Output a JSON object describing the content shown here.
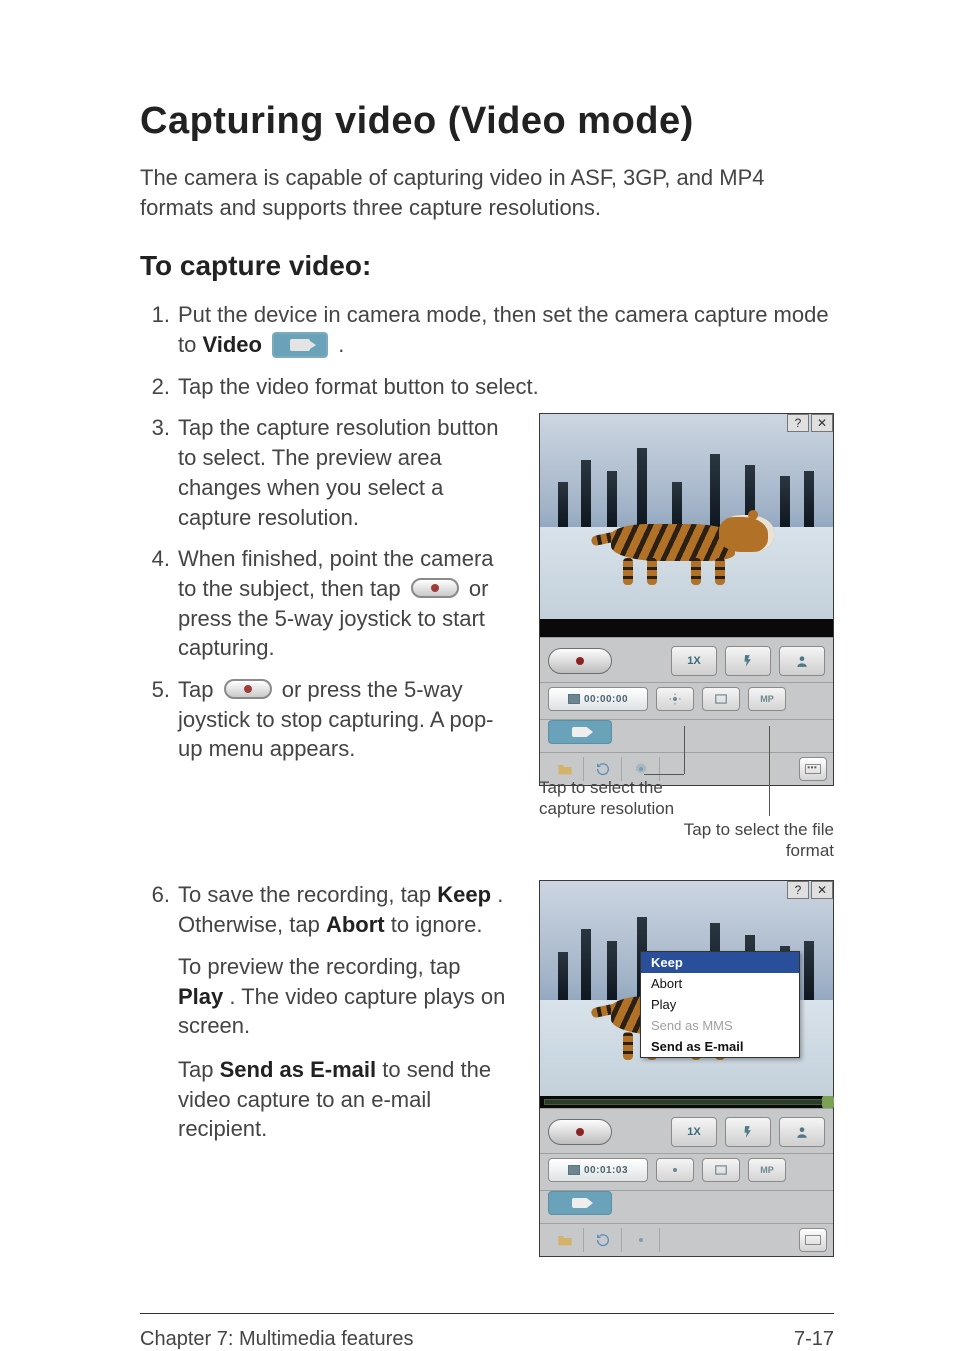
{
  "heading": "Capturing video (Video mode)",
  "intro": "The camera is capable of capturing video in ASF, 3GP, and MP4 formats and supports three capture resolutions.",
  "subheading": "To capture video:",
  "steps": {
    "s1a": "Put the device in camera mode, then set the camera capture mode to ",
    "s1b_bold": "Video",
    "s1c": ".",
    "s2": "Tap the video format button to select.",
    "s3": "Tap the capture resolution button to select. The preview area changes when you select a capture resolution.",
    "s4a": "When finished, point the camera to the subject, then tap ",
    "s4b": " or press the 5-way joystick to start capturing.",
    "s5a": "Tap ",
    "s5b": " or press the 5-way joystick to stop capturing. A pop-up menu appears.",
    "s6a": "To save the recording, tap ",
    "s6_keep": "Keep",
    "s6b": ". Otherwise, tap ",
    "s6_abort": "Abort",
    "s6c": " to ignore.",
    "s6_p2a": "To preview the recording, tap ",
    "s6_play": "Play",
    "s6_p2b": ". The video capture plays on screen.",
    "s6_p3a": "Tap ",
    "s6_sendmail": "Send as E-mail",
    "s6_p3b": " to send the video capture to an e-mail recipient."
  },
  "nums": {
    "n1": "1.",
    "n2": "2.",
    "n3": "3.",
    "n4": "4.",
    "n5": "5.",
    "n6": "6."
  },
  "shot1": {
    "zoom_label": "1X",
    "timer": "00:00:00",
    "help_glyph": "?",
    "close_glyph": "✕",
    "callout_res": "Tap to select the capture resolution",
    "callout_fmt": "Tap to select the file format"
  },
  "shot2": {
    "zoom_label": "1X",
    "timer": "00:01:03",
    "help_glyph": "?",
    "close_glyph": "✕",
    "menu": {
      "keep": "Keep",
      "abort": "Abort",
      "play": "Play",
      "send_mms": "Send as MMS",
      "send_email": "Send as E-mail"
    }
  },
  "footer": {
    "left": "Chapter 7: Multimedia features",
    "right": "7-17"
  }
}
